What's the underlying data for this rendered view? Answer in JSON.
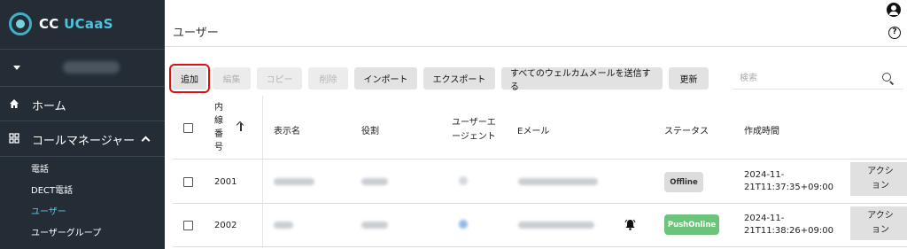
{
  "sidebar": {
    "logo": {
      "prefix": "CC ",
      "accent": "UCaaS"
    },
    "nav": [
      {
        "label": "ホーム",
        "icon": "home-icon"
      },
      {
        "label": "コールマネージャー",
        "icon": "grid-icon",
        "expanded": true
      }
    ],
    "sub_items": [
      {
        "label": "電話",
        "active": false
      },
      {
        "label": "DECT電話",
        "active": false
      },
      {
        "label": "ユーザー",
        "active": true
      },
      {
        "label": "ユーザーグループ",
        "active": false
      }
    ]
  },
  "header": {
    "title": "ユーザー"
  },
  "toolbar": {
    "buttons": [
      {
        "label": "追加",
        "enabled": true
      },
      {
        "label": "編集",
        "enabled": false
      },
      {
        "label": "コピー",
        "enabled": false
      },
      {
        "label": "削除",
        "enabled": false
      },
      {
        "label": "インポート",
        "enabled": true
      },
      {
        "label": "エクスポート",
        "enabled": true
      },
      {
        "label": "すべてのウェルカムメールを送信する",
        "enabled": true
      },
      {
        "label": "更新",
        "enabled": true
      }
    ],
    "search_placeholder": "検索"
  },
  "table": {
    "columns": {
      "ext_line1": "内",
      "ext_line2": "線",
      "ext_line3": "番",
      "ext_line4": "号",
      "display_name": "表示名",
      "role": "役割",
      "user_agent_1": "ユーザーエ",
      "user_agent_2": "ージェント",
      "email": "Eメール",
      "status": "ステータス",
      "created": "作成時間"
    },
    "rows": [
      {
        "ext": "2001",
        "status": "Offline",
        "status_online": false,
        "created_1": "2024-11-",
        "created_2": "21T11:37:35+09:00",
        "action_1": "アクシ",
        "action_2": "ョン",
        "has_bell": false
      },
      {
        "ext": "2002",
        "status": "PushOnline",
        "status_online": true,
        "created_1": "2024-11-",
        "created_2": "21T11:38:26+09:00",
        "action_1": "アクシ",
        "action_2": "ョン",
        "has_bell": true
      }
    ]
  },
  "colors": {
    "sidebar_bg": "#242d35",
    "accent": "#4ec3dc",
    "active_link": "#5fc6ea",
    "online": "#6cc47a",
    "highlight_outline": "#e01010"
  }
}
